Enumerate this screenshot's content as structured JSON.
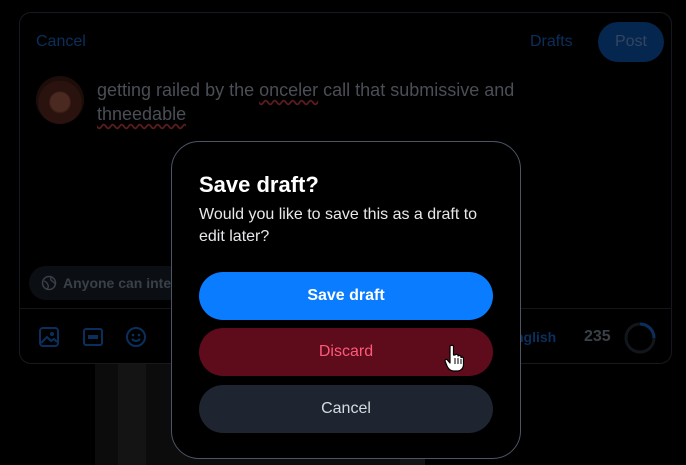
{
  "composer": {
    "cancel_label": "Cancel",
    "drafts_label": "Drafts",
    "post_label": "Post",
    "text_before": "getting railed by the ",
    "text_misspelled_1": "onceler",
    "text_middle": " call that submissive and ",
    "text_misspelled_2": "thneedable",
    "audience_label": "Anyone can inte",
    "language_label": "nglish",
    "char_count": "235",
    "icons": [
      "image-icon",
      "gif-icon",
      "emoji-icon",
      "globe-icon"
    ]
  },
  "dialog": {
    "title": "Save draft?",
    "description": "Would you like to save this as a draft to edit later?",
    "save_label": "Save draft",
    "discard_label": "Discard",
    "cancel_label": "Cancel"
  },
  "colors": {
    "primary": "#0a7cff",
    "discard_bg": "#5e0b1b",
    "discard_text": "#ff5a7a",
    "cancel_bg": "#1e2530"
  }
}
